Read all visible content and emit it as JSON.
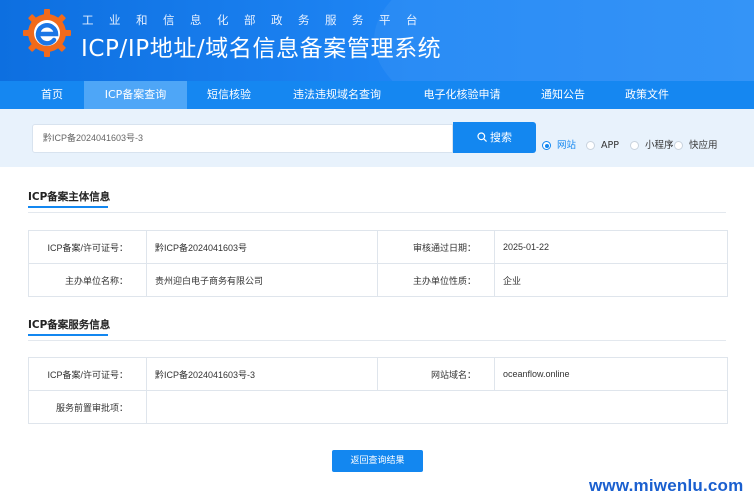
{
  "header": {
    "subtitle": "工业和信息化部政务服务平台",
    "title": "ICP/IP地址/域名信息备案管理系统"
  },
  "nav": {
    "items": [
      {
        "label": "首页"
      },
      {
        "label": "ICP备案查询",
        "active": true
      },
      {
        "label": "短信核验"
      },
      {
        "label": "违法违规域名查询"
      },
      {
        "label": "电子化核验申请"
      },
      {
        "label": "通知公告"
      },
      {
        "label": "政策文件"
      }
    ]
  },
  "search": {
    "value": "黔ICP备2024041603号-3",
    "button_label": "搜索",
    "options": [
      {
        "label": "网站",
        "checked": true
      },
      {
        "label": "APP"
      },
      {
        "label": "小程序"
      },
      {
        "label": "快应用"
      }
    ]
  },
  "subject": {
    "title": "ICP备案主体信息",
    "rows": [
      {
        "label1": "ICP备案/许可证号：",
        "value1": "黔ICP备2024041603号",
        "label2": "审核通过日期：",
        "value2": "2025-01-22"
      },
      {
        "label1": "主办单位名称：",
        "value1": "贵州迎白电子商务有限公司",
        "label2": "主办单位性质：",
        "value2": "企业"
      }
    ]
  },
  "service": {
    "title": "ICP备案服务信息",
    "rows": [
      {
        "label1": "ICP备案/许可证号：",
        "value1": "黔ICP备2024041603号-3",
        "label2": "网站域名：",
        "value2": "oceanflow.online"
      },
      {
        "label1": "服务前置审批项：",
        "value1": ""
      }
    ]
  },
  "return_button": "返回查询结果",
  "watermark": "www.miwenlu.com",
  "colors": {
    "primary": "#1387f0",
    "nav": "#1587f1",
    "nav_active": "#4ea6f7",
    "search_band": "#e8f2fc",
    "logo_orange": "#f26a1b"
  }
}
